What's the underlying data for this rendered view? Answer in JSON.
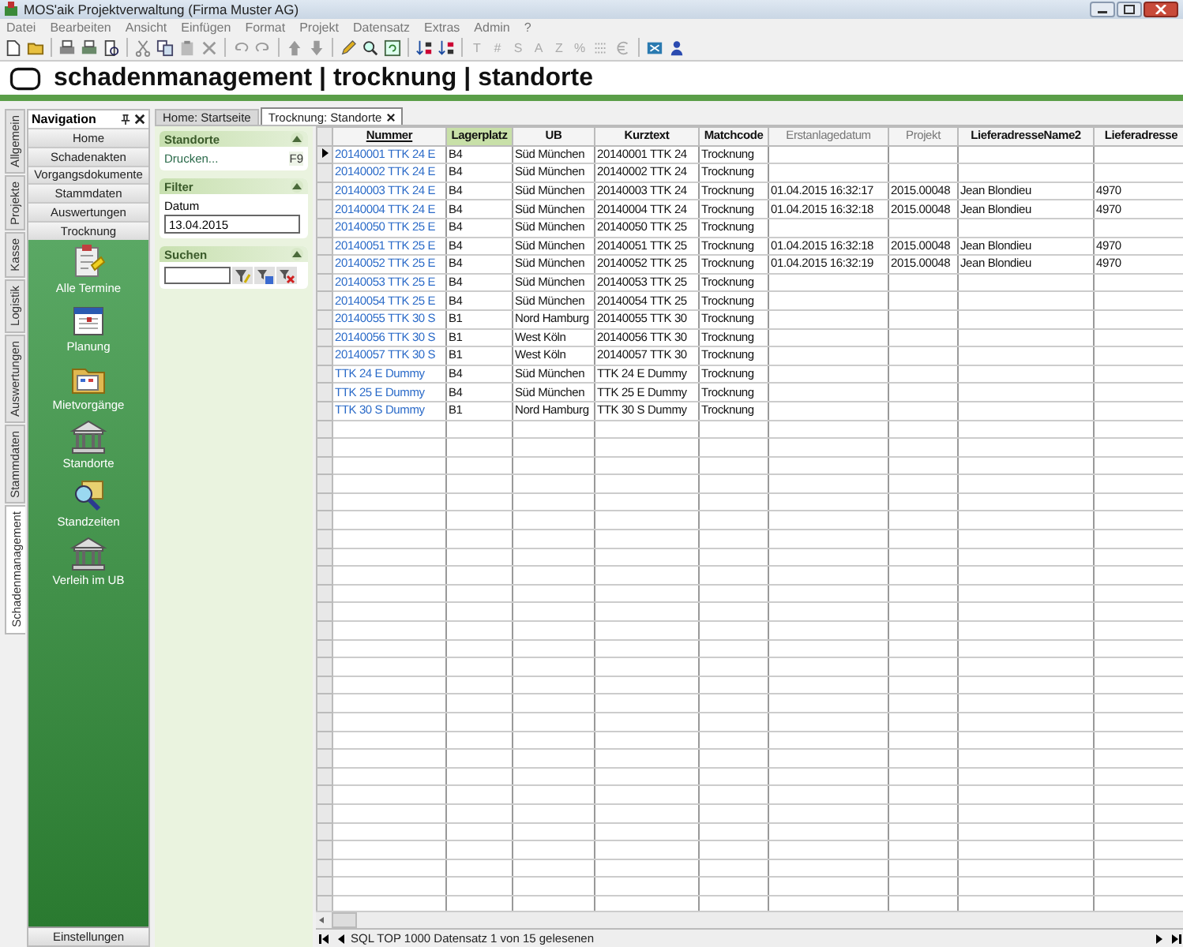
{
  "window": {
    "title": "MOS'aik Projektverwaltung (Firma Muster AG)"
  },
  "menu": [
    "Datei",
    "Bearbeiten",
    "Ansicht",
    "Einfügen",
    "Format",
    "Projekt",
    "Datensatz",
    "Extras",
    "Admin",
    "?"
  ],
  "toolbar": {
    "text_buttons": [
      {
        "label": "T",
        "disabled": true
      },
      {
        "label": "#",
        "disabled": true
      },
      {
        "label": "S",
        "disabled": true
      },
      {
        "label": "A",
        "disabled": true
      },
      {
        "label": "Z",
        "disabled": true
      },
      {
        "label": "%",
        "disabled": true
      }
    ]
  },
  "header": {
    "title": "schadenmanagement | trocknung | standorte"
  },
  "side_tabs": [
    {
      "label": "Allgemein",
      "selected": false
    },
    {
      "label": "Projekte",
      "selected": false
    },
    {
      "label": "Kasse",
      "selected": false
    },
    {
      "label": "Logistik",
      "selected": false
    },
    {
      "label": "Auswertungen",
      "selected": false
    },
    {
      "label": "Stammdaten",
      "selected": false
    },
    {
      "label": "Schadenmanagement",
      "selected": true
    }
  ],
  "navigation": {
    "title": "Navigation",
    "buttons": [
      "Home",
      "Schadenakten",
      "Vorgangsdokumente",
      "Stammdaten",
      "Auswertungen",
      "Trocknung"
    ],
    "items": [
      "Alle Termine",
      "Planung",
      "Mietvorgänge",
      "Standorte",
      "Standzeiten",
      "Verleih im UB"
    ],
    "footer_button": "Einstellungen"
  },
  "doc_tabs": [
    {
      "label": "Home: Startseite",
      "selected": false,
      "closable": false
    },
    {
      "label": "Trocknung: Standorte",
      "selected": true,
      "closable": true
    }
  ],
  "task_panel": {
    "sections": [
      {
        "kind": "actions",
        "title": "Standorte",
        "expanded": true,
        "actions": [
          {
            "label": "Drucken...",
            "shortcut": "F9"
          }
        ]
      },
      {
        "kind": "filter",
        "title": "Filter",
        "expanded": true,
        "field_label": "Datum",
        "value": "13.04.2015"
      },
      {
        "kind": "search",
        "title": "Suchen",
        "expanded": true
      }
    ]
  },
  "table": {
    "columns": [
      {
        "label": "Nummer",
        "kind": "sorted"
      },
      {
        "label": "Lagerplatz",
        "kind": "highlighted"
      },
      {
        "label": "UB",
        "kind": "normal"
      },
      {
        "label": "Kurztext",
        "kind": "normal"
      },
      {
        "label": "Matchcode",
        "kind": "normal"
      },
      {
        "label": "Erstanlagedatum",
        "kind": "dimmed"
      },
      {
        "label": "Projekt",
        "kind": "dimmed"
      },
      {
        "label": "LieferadresseName2",
        "kind": "normal"
      },
      {
        "label": "Lieferadresse",
        "kind": "normal"
      }
    ],
    "rows": [
      {
        "selected": true,
        "cells": [
          "20140001 TTK 24 E",
          "B4",
          "Süd München",
          "20140001 TTK 24",
          "Trocknung",
          "",
          "",
          "",
          ""
        ]
      },
      {
        "selected": false,
        "cells": [
          "20140002 TTK 24 E",
          "B4",
          "Süd München",
          "20140002 TTK 24",
          "Trocknung",
          "",
          "",
          "",
          ""
        ]
      },
      {
        "selected": false,
        "cells": [
          "20140003 TTK 24 E",
          "B4",
          "Süd München",
          "20140003 TTK 24",
          "Trocknung",
          "01.04.2015 16:32:17",
          "2015.00048",
          "Jean Blondieu",
          "4970"
        ]
      },
      {
        "selected": false,
        "cells": [
          "20140004 TTK 24 E",
          "B4",
          "Süd München",
          "20140004 TTK 24",
          "Trocknung",
          "01.04.2015 16:32:18",
          "2015.00048",
          "Jean Blondieu",
          "4970"
        ]
      },
      {
        "selected": false,
        "cells": [
          "20140050 TTK 25 E",
          "B4",
          "Süd München",
          "20140050 TTK 25",
          "Trocknung",
          "",
          "",
          "",
          ""
        ]
      },
      {
        "selected": false,
        "cells": [
          "20140051 TTK 25 E",
          "B4",
          "Süd München",
          "20140051 TTK 25",
          "Trocknung",
          "01.04.2015 16:32:18",
          "2015.00048",
          "Jean Blondieu",
          "4970"
        ]
      },
      {
        "selected": false,
        "cells": [
          "20140052 TTK 25 E",
          "B4",
          "Süd München",
          "20140052 TTK 25",
          "Trocknung",
          "01.04.2015 16:32:19",
          "2015.00048",
          "Jean Blondieu",
          "4970"
        ]
      },
      {
        "selected": false,
        "cells": [
          "20140053 TTK 25 E",
          "B4",
          "Süd München",
          "20140053 TTK 25",
          "Trocknung",
          "",
          "",
          "",
          ""
        ]
      },
      {
        "selected": false,
        "cells": [
          "20140054 TTK 25 E",
          "B4",
          "Süd München",
          "20140054 TTK 25",
          "Trocknung",
          "",
          "",
          "",
          ""
        ]
      },
      {
        "selected": false,
        "cells": [
          "20140055 TTK 30 S",
          "B1",
          "Nord Hamburg",
          "20140055 TTK 30",
          "Trocknung",
          "",
          "",
          "",
          ""
        ]
      },
      {
        "selected": false,
        "cells": [
          "20140056 TTK 30 S",
          "B1",
          "West Köln",
          "20140056 TTK 30",
          "Trocknung",
          "",
          "",
          "",
          ""
        ]
      },
      {
        "selected": false,
        "cells": [
          "20140057 TTK 30 S",
          "B1",
          "West Köln",
          "20140057 TTK 30",
          "Trocknung",
          "",
          "",
          "",
          ""
        ]
      },
      {
        "selected": false,
        "cells": [
          "TTK 24 E Dummy",
          "B4",
          "Süd München",
          "TTK 24 E Dummy",
          "Trocknung",
          "",
          "",
          "",
          ""
        ]
      },
      {
        "selected": false,
        "cells": [
          "TTK 25 E Dummy",
          "B4",
          "Süd München",
          "TTK 25 E Dummy",
          "Trocknung",
          "",
          "",
          "",
          ""
        ]
      },
      {
        "selected": false,
        "cells": [
          "TTK 30 S Dummy",
          "B1",
          "Nord Hamburg",
          "TTK 30 S Dummy",
          "Trocknung",
          "",
          "",
          "",
          ""
        ]
      }
    ]
  },
  "status_bar": {
    "text": "SQL TOP 1000 Datensatz 1 von 15 gelesenen"
  }
}
